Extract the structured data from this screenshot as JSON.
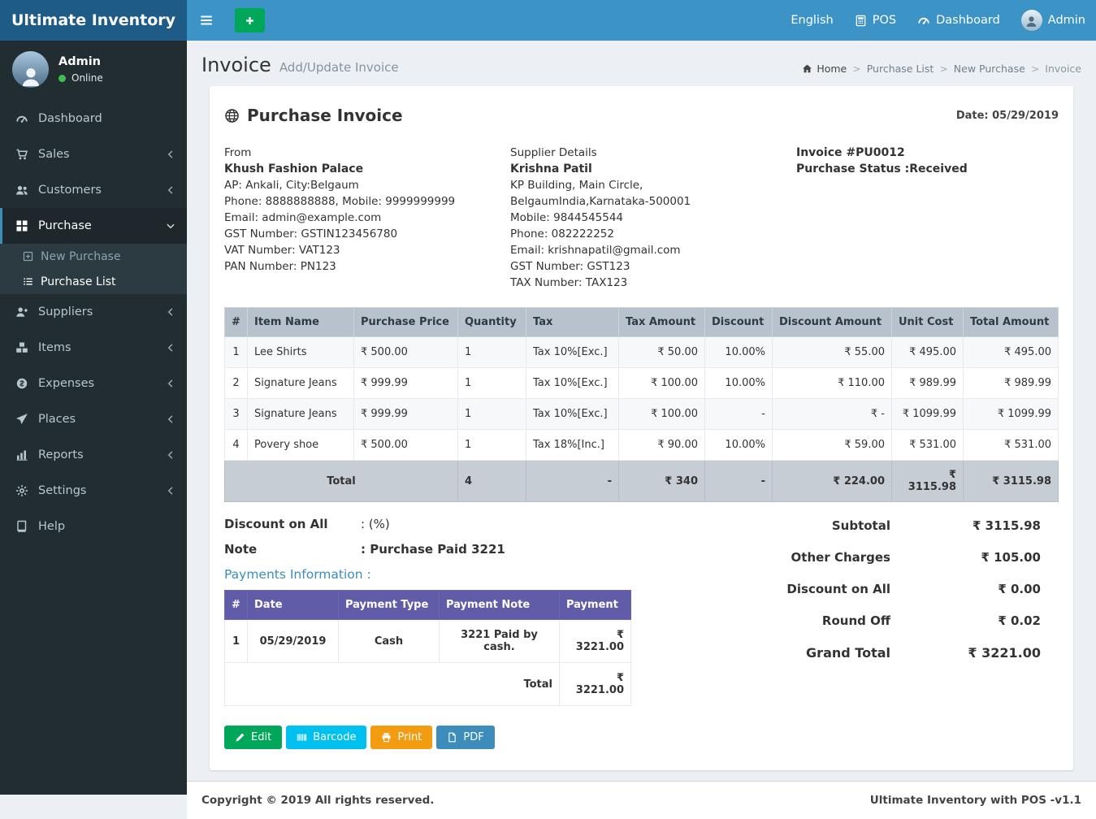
{
  "app": {
    "title": "Ultimate Inventory"
  },
  "topbar": {
    "language": "English",
    "pos": "POS",
    "dashboard": "Dashboard",
    "user": "Admin"
  },
  "sidebar": {
    "user": {
      "name": "Admin",
      "status": "Online"
    },
    "items": [
      {
        "label": "Dashboard"
      },
      {
        "label": "Sales"
      },
      {
        "label": "Customers"
      },
      {
        "label": "Purchase"
      },
      {
        "label": "New Purchase"
      },
      {
        "label": "Purchase List"
      },
      {
        "label": "Suppliers"
      },
      {
        "label": "Items"
      },
      {
        "label": "Expenses"
      },
      {
        "label": "Places"
      },
      {
        "label": "Reports"
      },
      {
        "label": "Settings"
      },
      {
        "label": "Help"
      }
    ]
  },
  "page": {
    "title": "Invoice",
    "subtitle": "Add/Update Invoice",
    "breadcrumb": {
      "home": "Home",
      "sep": ">",
      "items": [
        "Purchase List",
        "New Purchase",
        "Invoice"
      ]
    }
  },
  "invoice": {
    "title": "Purchase Invoice",
    "date": "Date: 05/29/2019",
    "from": {
      "heading": "From",
      "name": "Khush Fashion Palace",
      "lines": [
        "AP: Ankali, City:Belgaum",
        "Phone: 8888888888, Mobile: 9999999999",
        "Email: admin@example.com",
        "GST Number: GSTIN123456780",
        "VAT Number: VAT123",
        "PAN Number: PN123"
      ]
    },
    "supplier": {
      "heading": "Supplier Details",
      "name": "Krishna Patil",
      "lines": [
        "KP Building, Main Circle, BelgaumIndia,Karnataka-500001",
        "Mobile: 9844545544",
        "Phone: 082222252",
        "Email: krishnapatil@gmail.com",
        "GST Number: GST123",
        "TAX Number: TAX123"
      ]
    },
    "meta": {
      "number": "Invoice #PU0012",
      "status": "Purchase Status :Received"
    }
  },
  "items_table": {
    "headers": [
      "#",
      "Item Name",
      "Purchase Price",
      "Quantity",
      "Tax",
      "Tax Amount",
      "Discount",
      "Discount Amount",
      "Unit Cost",
      "Total Amount"
    ],
    "rows": [
      [
        "1",
        "Lee Shirts",
        "₹ 500.00",
        "1",
        "Tax 10%[Exc.]",
        "₹ 50.00",
        "10.00%",
        "₹ 55.00",
        "₹ 495.00",
        "₹ 495.00"
      ],
      [
        "2",
        "Signature Jeans",
        "₹ 999.99",
        "1",
        "Tax 10%[Exc.]",
        "₹ 100.00",
        "10.00%",
        "₹ 110.00",
        "₹ 989.99",
        "₹ 989.99"
      ],
      [
        "3",
        "Signature Jeans",
        "₹ 999.99",
        "1",
        "Tax 10%[Exc.]",
        "₹ 100.00",
        "-",
        "₹ -",
        "₹ 1099.99",
        "₹ 1099.99"
      ],
      [
        "4",
        "Povery shoe",
        "₹ 500.00",
        "1",
        "Tax 18%[Inc.]",
        "₹ 90.00",
        "10.00%",
        "₹ 59.00",
        "₹ 531.00",
        "₹ 531.00"
      ]
    ],
    "total_row": [
      "Total",
      "4",
      "-",
      "₹ 340",
      "-",
      "₹ 224.00",
      "₹ 3115.98",
      "₹ 3115.98"
    ]
  },
  "extras": {
    "discount_label": "Discount on All",
    "discount_value": ": (%)",
    "note_label": "Note",
    "note_value": ": Purchase Paid 3221"
  },
  "payments": {
    "title": "Payments Information :",
    "headers": [
      "#",
      "Date",
      "Payment Type",
      "Payment Note",
      "Payment"
    ],
    "rows": [
      [
        "1",
        "05/29/2019",
        "Cash",
        "3221 Paid by cash.",
        "₹ 3221.00"
      ]
    ],
    "total_label": "Total",
    "total_value": "₹ 3221.00"
  },
  "summary": {
    "rows": [
      {
        "label": "Subtotal",
        "value": "₹ 3115.98"
      },
      {
        "label": "Other Charges",
        "value": "₹ 105.00"
      },
      {
        "label": "Discount on All",
        "value": "₹ 0.00"
      },
      {
        "label": "Round Off",
        "value": "₹ 0.02"
      },
      {
        "label": "Grand Total",
        "value": "₹ 3221.00"
      }
    ]
  },
  "actions": {
    "edit": "Edit",
    "barcode": "Barcode",
    "print": "Print",
    "pdf": "PDF"
  },
  "footer": {
    "copyright": "Copyright © 2019 All rights reserved.",
    "version": "Ultimate Inventory with POS -v1.1"
  },
  "colors": {
    "navbar": "#3b93c6",
    "logo_bg": "#1e5c87",
    "sidebar_bg": "#222d32",
    "accent": "#3c8dbc",
    "table_header": "#b8c2cc",
    "payments_header": "#605ca8",
    "success": "#00a65a",
    "info": "#00c0ef",
    "warning": "#f39c12",
    "online": "#3fbf4e"
  },
  "icons": {
    "menu-icon": "three horizontal bars",
    "plus-icon": "plus sign",
    "calculator-icon": "calculator (POS)",
    "gauge-icon": "speedometer gauge (dashboard)",
    "user-icon": "person silhouette",
    "cart-icon": "shopping cart",
    "users-icon": "two people",
    "grid-icon": "2x2 squares",
    "plus-square-icon": "square with plus",
    "list-icon": "bulleted list",
    "user-plus-icon": "person with plus",
    "cubes-icon": "stacked cubes",
    "coin-icon": "coin / money",
    "paper-plane-icon": "paper plane",
    "bar-chart-icon": "bar chart",
    "gear-icon": "gear",
    "book-icon": "book",
    "globe-icon": "globe",
    "home-icon": "house",
    "chevron-left-icon": "angle pointing left",
    "chevron-down-icon": "angle pointing down",
    "edit-icon": "pencil",
    "barcode-icon": "barcode stripes",
    "print-icon": "printer",
    "pdf-icon": "document file"
  }
}
